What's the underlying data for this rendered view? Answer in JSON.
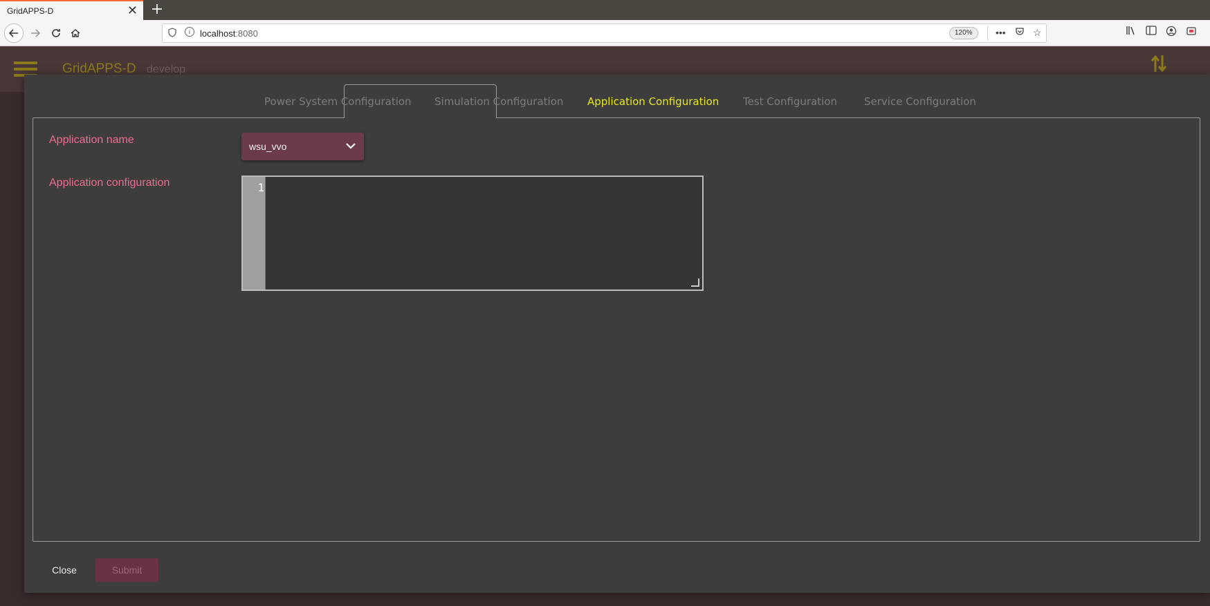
{
  "browser": {
    "tab_title": "GridAPPS-D",
    "tab_close": "✕",
    "new_tab": "+",
    "url_host": "localhost",
    "url_port": ":8080",
    "zoom": "120%"
  },
  "app": {
    "title": "GridAPPS-D",
    "branch": "develop"
  },
  "dialog": {
    "tabs": [
      {
        "label": "Power System Configuration"
      },
      {
        "label": "Simulation Configuration"
      },
      {
        "label": "Application Configuration"
      },
      {
        "label": "Test Configuration"
      },
      {
        "label": "Service Configuration"
      }
    ],
    "active_tab": "Application Configuration",
    "app_name_label": "Application name",
    "app_name_value": "wsu_vvo",
    "app_config_label": "Application configuration",
    "editor_line_number": "1",
    "editor_content": "",
    "close_label": "Close",
    "submit_label": "Submit"
  },
  "colors": {
    "accent_yellow": "#e8e81c",
    "label_pink": "#f06b8e",
    "select_bg": "#6b3a4b",
    "submit_bg": "#6a3247",
    "app_title": "#8d7a1a"
  }
}
